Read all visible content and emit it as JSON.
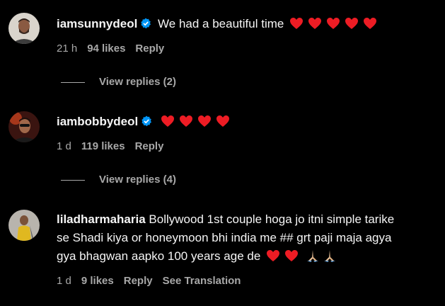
{
  "comments": [
    {
      "username": "iamsunnydeol",
      "verified": true,
      "text": "We had a beautiful time",
      "hearts": 5,
      "time": "21 h",
      "likes": "94 likes",
      "reply": "Reply",
      "view_replies": "View replies (2)"
    },
    {
      "username": "iambobbydeol",
      "verified": true,
      "text": "",
      "hearts": 4,
      "time": "1 d",
      "likes": "119 likes",
      "reply": "Reply",
      "view_replies": "View replies (4)"
    },
    {
      "username": "liladharmaharia",
      "verified": false,
      "text_line1": "Bollywood 1st couple hoga jo itni simple tarike",
      "text_line2": "se Shadi kiya or honeymoon bhi india me ## grt paji maja agya",
      "text_line3": "gya bhagwan aapko 100 years age de",
      "hearts": 2,
      "hands": 2,
      "time": "1 d",
      "likes": "9 likes",
      "reply": "Reply",
      "translate": "See Translation"
    }
  ],
  "colors": {
    "background": "#000000",
    "text": "#f5f5f5",
    "meta": "#a8a8a8",
    "verified": "#0095f6",
    "heart": "#ed1c24"
  },
  "icons": [
    "verified-badge-icon",
    "red-heart-icon",
    "folded-hands-icon"
  ]
}
